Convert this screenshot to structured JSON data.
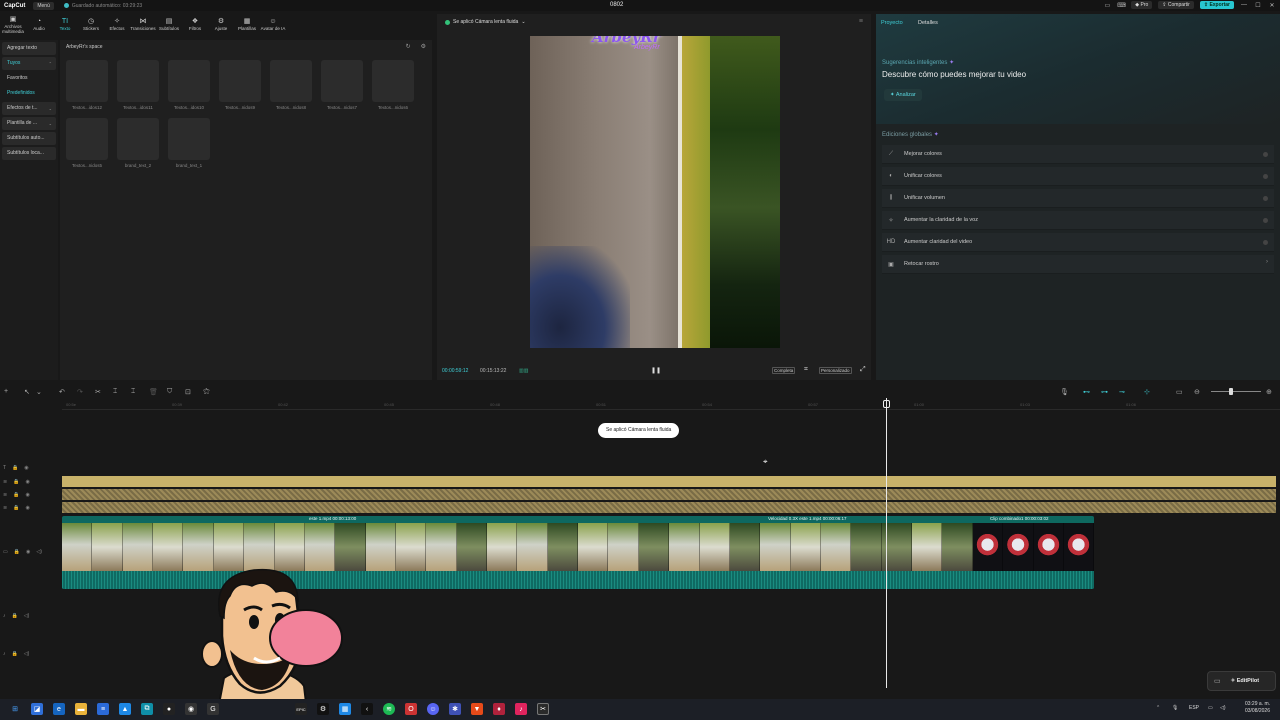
{
  "titlebar": {
    "logo": "CapCut",
    "menu": "Menú",
    "saved": "Guardado automático: 03:29:23",
    "project": "0802",
    "pro": "Pro",
    "share": "Compartir",
    "export": "Exportar"
  },
  "toolbar": [
    {
      "label": "Archivos multimedia",
      "icon": "media-icon"
    },
    {
      "label": "Audio",
      "icon": "audio-icon"
    },
    {
      "label": "Texto",
      "icon": "text-icon"
    },
    {
      "label": "Stickers",
      "icon": "sticker-icon"
    },
    {
      "label": "Efectos",
      "icon": "effects-icon"
    },
    {
      "label": "Transiciones",
      "icon": "transitions-icon"
    },
    {
      "label": "Subtítulos",
      "icon": "subtitles-icon"
    },
    {
      "label": "Filtros",
      "icon": "filters-icon"
    },
    {
      "label": "Ajuste",
      "icon": "adjust-icon"
    },
    {
      "label": "Plantillas",
      "icon": "templates-icon"
    },
    {
      "label": "Avatar de IA",
      "icon": "avatar-icon"
    }
  ],
  "leftnav": [
    "Agregar texto",
    "Tuyos",
    "Favoritos",
    "Predefinidos",
    "Efectos de t...",
    "Plantilla de ...",
    "Subtítulos auto...",
    "Subtítulos loca..."
  ],
  "assets": {
    "space_title": "ArbeyRr's space",
    "tiles": [
      "Textos...idos12",
      "Textos...idos11",
      "Textos...idos10",
      "Textos...nidos9",
      "Textos...nidos8",
      "Textos...nidos7",
      "Textos...nidos6",
      "Textos...nidos5",
      "brand_text_2",
      "brand_text_1"
    ]
  },
  "preview": {
    "status": "Se aplicó Cámara lenta fluida",
    "current_time": "00:00:59:12",
    "total_time": "00:15:13:22",
    "ratio_btn": "Completa",
    "custom_btn": "Personalizado",
    "watermark": "ArbeyRr",
    "watermark_small": "ArbeyRr"
  },
  "right": {
    "tab_project": "Proyecto",
    "tab_details": "Detalles",
    "smart_title": "Sugerencias inteligentes",
    "smart_desc": "Descubre cómo puedes mejorar tu video",
    "analyze": "Analizar",
    "global_title": "Ediciones globales",
    "features": [
      {
        "label": "Mejorar colores",
        "icon": "magic-wand-icon"
      },
      {
        "label": "Unificar colores",
        "icon": "palette-icon"
      },
      {
        "label": "Unificar volumen",
        "icon": "equalizer-icon"
      },
      {
        "label": "Aumentar la claridad de la voz",
        "icon": "voice-icon"
      },
      {
        "label": "Aumentar claridad del video",
        "icon": "hd-icon"
      },
      {
        "label": "Retocar rostro",
        "icon": "face-icon"
      }
    ]
  },
  "timeline": {
    "ruler": [
      "00:5e",
      "00:39",
      "00:42",
      "00:45",
      "00:48",
      "00:51",
      "00:54",
      "00:57",
      "01:00",
      "01:03",
      "01:06"
    ],
    "tooltip": "Se aplicó Cámara lenta fluida",
    "clip1_label": "este 1.mp4   00:00:13:00",
    "clip2_label": "Velocidad 0.3X   este 1.mp4   00:00:06:17",
    "clip3_label": "Clip combinado1   00:00:03:02",
    "editpilot": "EditPilot"
  },
  "taskbar": {
    "lang": "ESP",
    "time": "03:29 a. m.",
    "date": "03/08/2026"
  }
}
